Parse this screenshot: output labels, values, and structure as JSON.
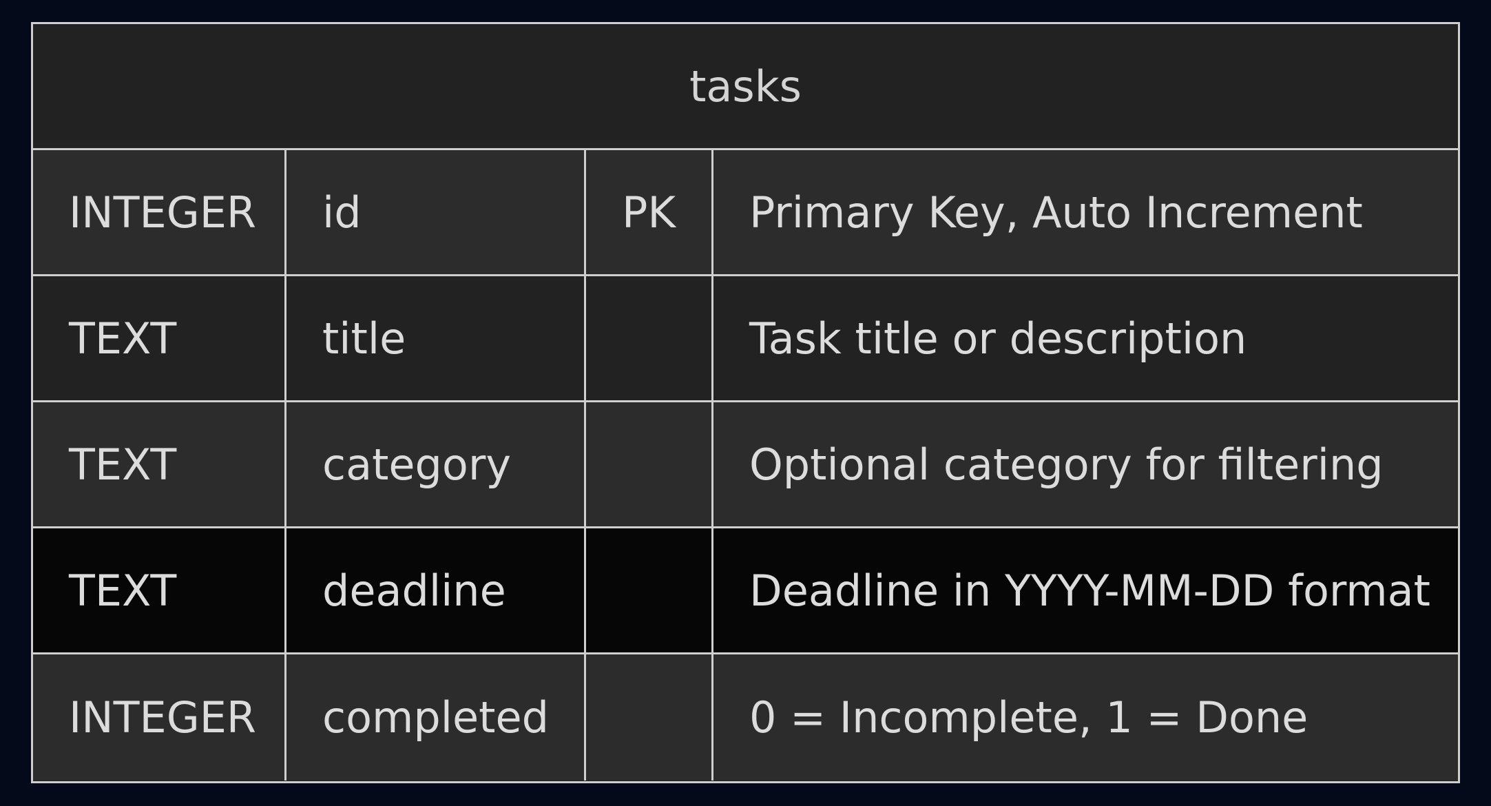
{
  "entity": {
    "name": "tasks",
    "attributes": [
      {
        "type": "INTEGER",
        "name": "id",
        "key": "PK",
        "comment": "Primary Key, Auto Increment"
      },
      {
        "type": "TEXT",
        "name": "title",
        "key": "",
        "comment": "Task title or description"
      },
      {
        "type": "TEXT",
        "name": "category",
        "key": "",
        "comment": "Optional category for filtering"
      },
      {
        "type": "TEXT",
        "name": "deadline",
        "key": "",
        "comment": "Deadline in YYYY-MM-DD format"
      },
      {
        "type": "INTEGER",
        "name": "completed",
        "key": "",
        "comment": "0 = Incomplete, 1 = Done"
      }
    ]
  },
  "colors": {
    "background": "#050a1a",
    "border": "#cfcfcf",
    "row_light": "#2c2c2c",
    "row_dark": "#222222",
    "row_highlight": "#060606",
    "text": "#dcdcdc"
  }
}
